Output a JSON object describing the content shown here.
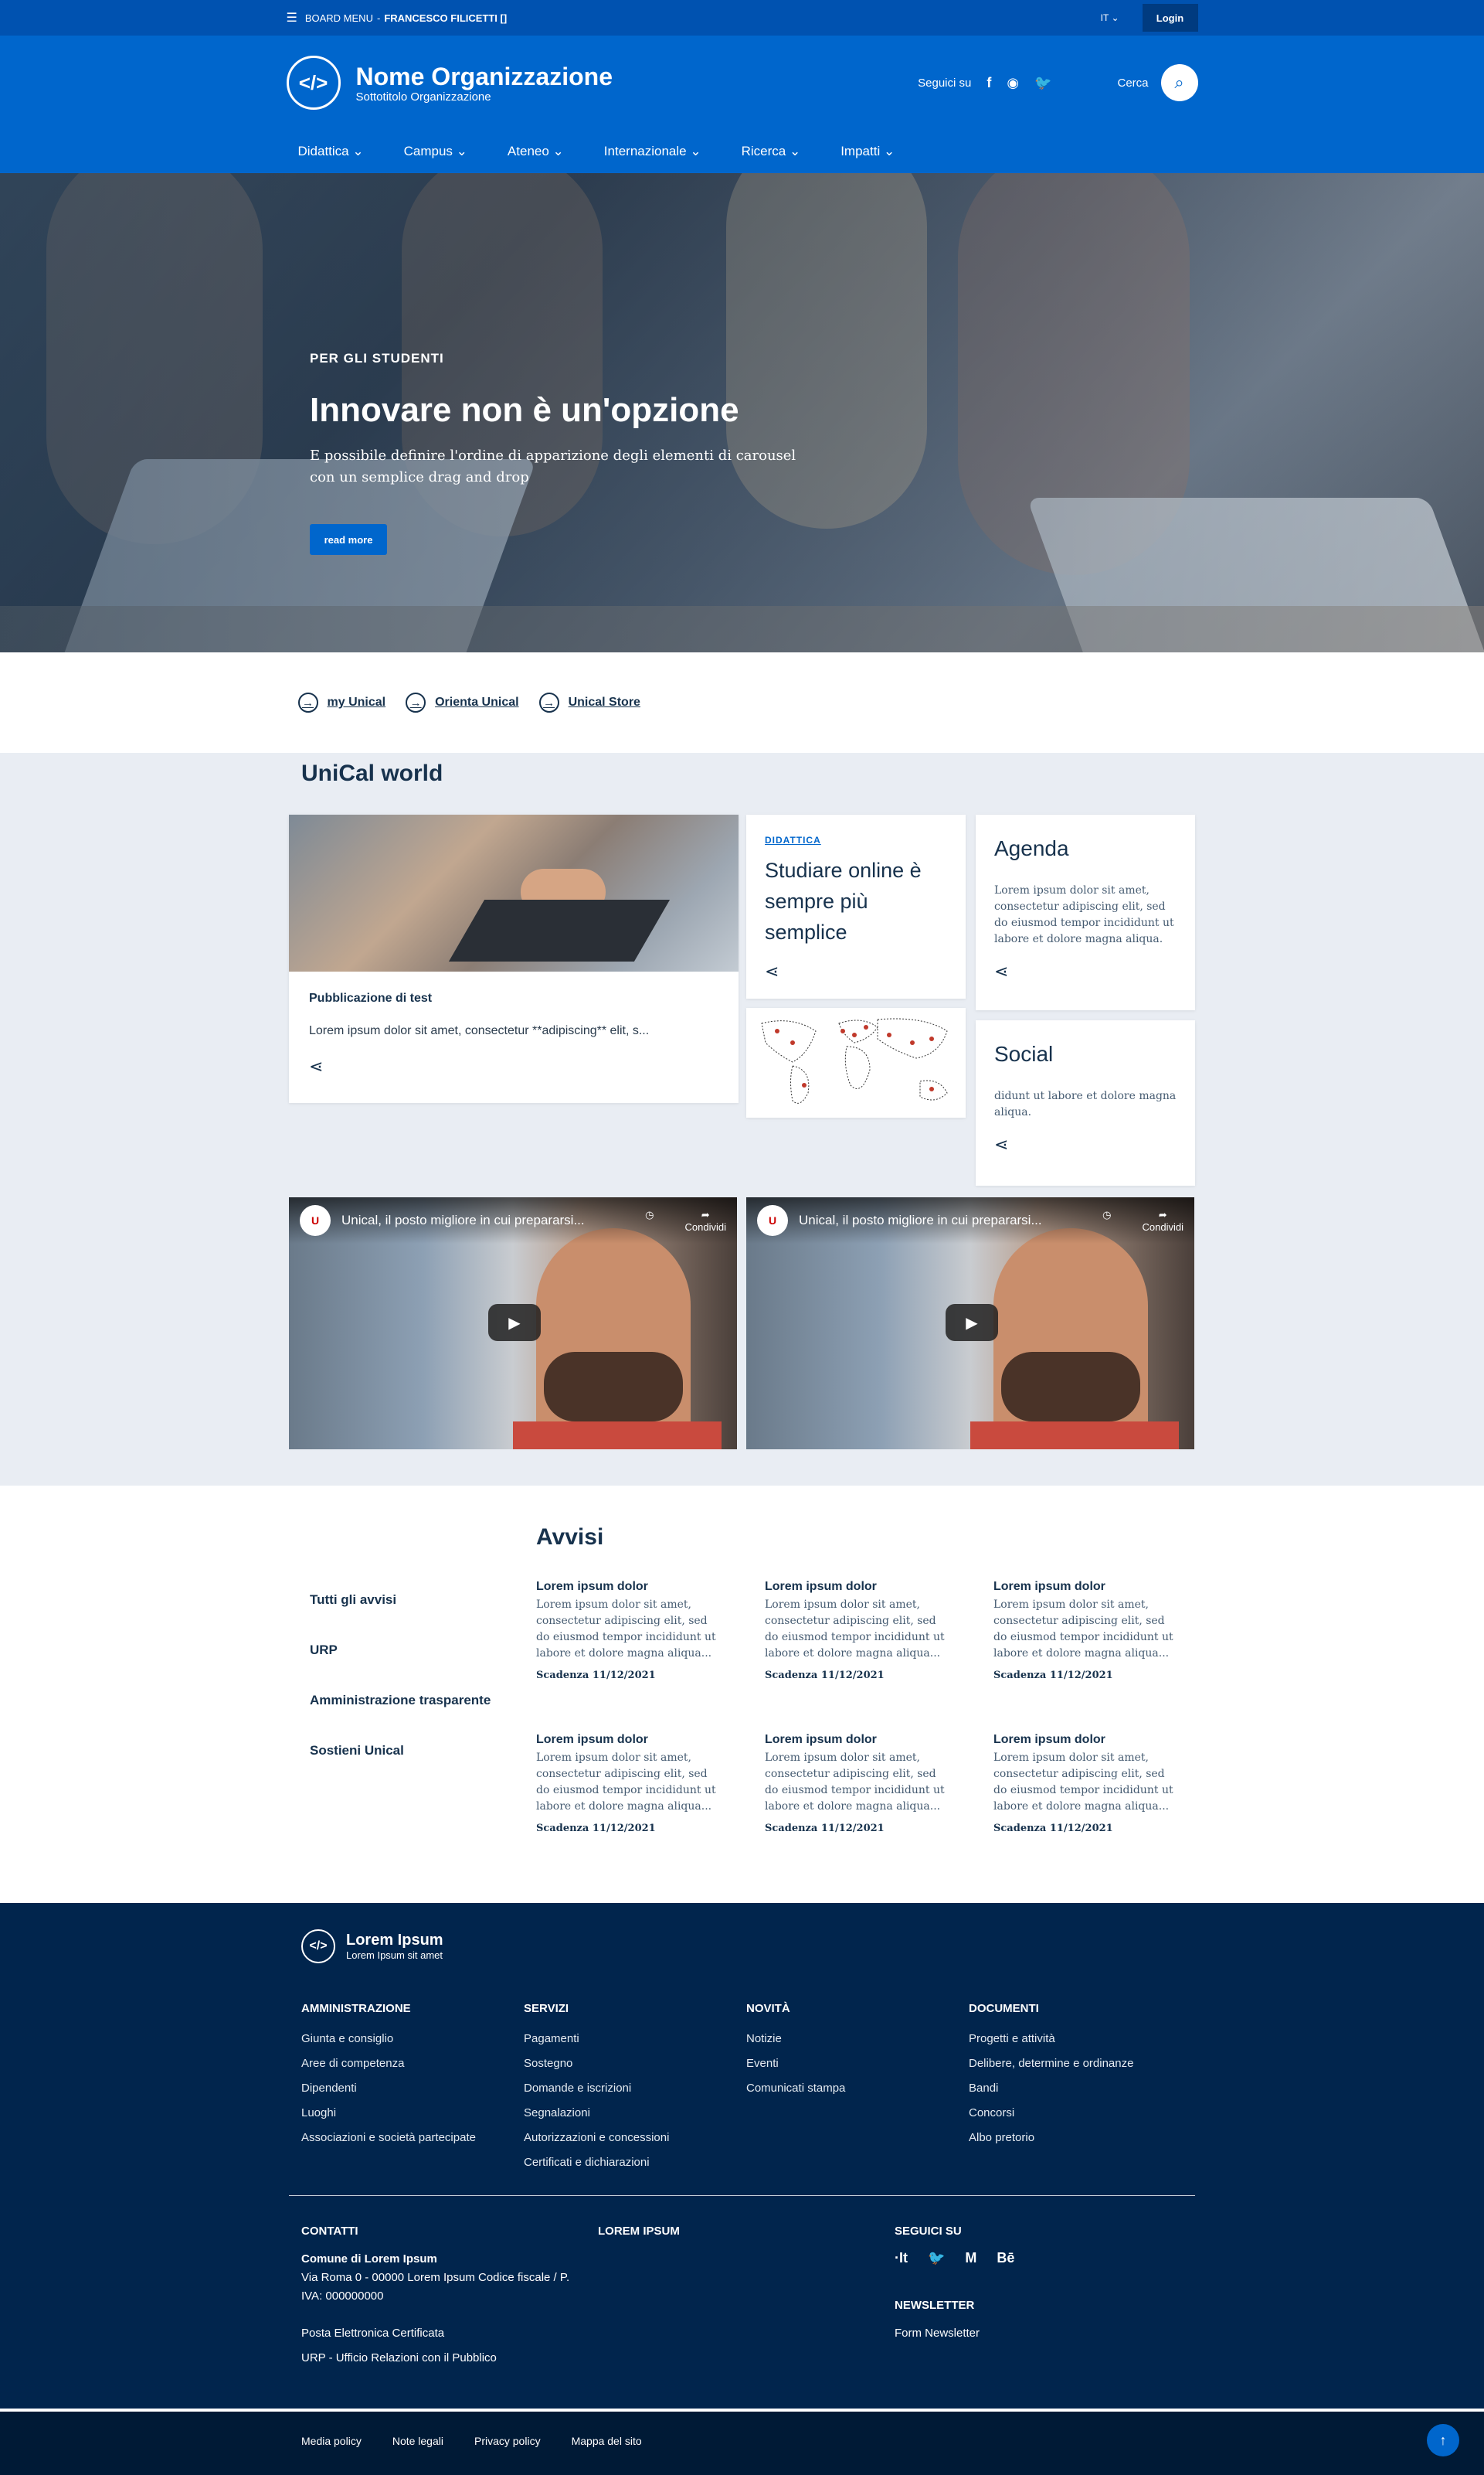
{
  "slim": {
    "menu_label": "BOARD MENU",
    "separator": "-",
    "user": "FRANCESCO FILICETTI []",
    "lang": "IT",
    "login": "Login"
  },
  "brand": {
    "title": "Nome Organizzazione",
    "subtitle": "Sottotitolo Organizzazione",
    "follow_label": "Seguici su",
    "search_label": "Cerca"
  },
  "nav": [
    {
      "label": "Didattica"
    },
    {
      "label": "Campus"
    },
    {
      "label": "Ateneo"
    },
    {
      "label": "Internazionale"
    },
    {
      "label": "Ricerca"
    },
    {
      "label": "Impatti"
    }
  ],
  "hero": {
    "kicker": "PER GLI STUDENTI",
    "title": "Innovare non è un'opzione",
    "text": "E possibile definire l'ordine di apparizione degli elementi di carousel con un semplice drag and drop",
    "button": "read more"
  },
  "quick_links": [
    "my Unical",
    "Orienta Unical",
    "Unical Store"
  ],
  "world": {
    "title": "UniCal world",
    "card_pub": {
      "title": "Pubblicazione di test",
      "text": "Lorem ipsum dolor sit amet, consectetur **adipiscing** elit, s..."
    },
    "card_did": {
      "category": "DIDATTICA",
      "title": "Studiare online è sempre più semplice"
    },
    "card_agenda": {
      "title": "Agenda",
      "text": "Lorem ipsum dolor sit amet, consectetur adipiscing elit, sed do eiusmod tempor incididunt ut labore et dolore magna aliqua."
    },
    "card_social": {
      "title": "Social",
      "text": "didunt ut labore et dolore magna aliqua."
    },
    "videos": [
      {
        "title": "Unical, il posto migliore in cui prepararsi...",
        "share": "Condividi"
      },
      {
        "title": "Unical, il posto migliore in cui prepararsi...",
        "share": "Condividi"
      }
    ]
  },
  "avvisi": {
    "title": "Avvisi",
    "menu": [
      "Tutti gli avvisi",
      "URP",
      "Amministrazione trasparente",
      "Sostieni Unical"
    ],
    "items": [
      {
        "title": "Lorem ipsum dolor",
        "text": "Lorem ipsum dolor sit amet, consectetur adipiscing elit, sed do eiusmod tempor incididunt ut labore et dolore magna aliqua...",
        "due": "Scadenza 11/12/2021"
      },
      {
        "title": "Lorem ipsum dolor",
        "text": "Lorem ipsum dolor sit amet, consectetur adipiscing elit, sed do eiusmod tempor incididunt ut labore et dolore magna aliqua...",
        "due": "Scadenza 11/12/2021"
      },
      {
        "title": "Lorem ipsum dolor",
        "text": "Lorem ipsum dolor sit amet, consectetur adipiscing elit, sed do eiusmod tempor incididunt ut labore et dolore magna aliqua...",
        "due": "Scadenza 11/12/2021"
      },
      {
        "title": "Lorem ipsum dolor",
        "text": "Lorem ipsum dolor sit amet, consectetur adipiscing elit, sed do eiusmod tempor incididunt ut labore et dolore magna aliqua...",
        "due": "Scadenza 11/12/2021"
      },
      {
        "title": "Lorem ipsum dolor",
        "text": "Lorem ipsum dolor sit amet, consectetur adipiscing elit, sed do eiusmod tempor incididunt ut labore et dolore magna aliqua...",
        "due": "Scadenza 11/12/2021"
      },
      {
        "title": "Lorem ipsum dolor",
        "text": "Lorem ipsum dolor sit amet, consectetur adipiscing elit, sed do eiusmod tempor incididunt ut labore et dolore magna aliqua...",
        "due": "Scadenza 11/12/2021"
      }
    ]
  },
  "footer": {
    "brand_title": "Lorem Ipsum",
    "brand_sub": "Lorem Ipsum sit amet",
    "cols": [
      {
        "title": "AMMINISTRAZIONE",
        "links": [
          "Giunta e consiglio",
          "Aree di competenza",
          "Dipendenti",
          "Luoghi",
          "Associazioni e società partecipate"
        ]
      },
      {
        "title": "SERVIZI",
        "links": [
          "Pagamenti",
          "Sostegno",
          "Domande e iscrizioni",
          "Segnalazioni",
          "Autorizzazioni e concessioni",
          "Certificati e dichiarazioni"
        ]
      },
      {
        "title": "NOVITÀ",
        "links": [
          "Notizie",
          "Eventi",
          "Comunicati stampa"
        ]
      },
      {
        "title": "DOCUMENTI",
        "links": [
          "Progetti e attività",
          "Delibere, determine e ordinanze",
          "Bandi",
          "Concorsi",
          "Albo pretorio"
        ]
      }
    ],
    "contacts_title": "CONTATTI",
    "contacts_name": "Comune di Lorem Ipsum",
    "contacts_addr": "Via Roma 0 - 00000 Lorem Ipsum Codice fiscale / P. IVA: 000000000",
    "pec": "Posta Elettronica Certificata",
    "urp": "URP - Ufficio Relazioni con il Pubblico",
    "lorem_title": "LOREM IPSUM",
    "follow_title": "SEGUICI SU",
    "social": [
      "·It",
      "🐦",
      "M",
      "Bē"
    ],
    "newsletter_title": "NEWSLETTER",
    "newsletter_link": "Form Newsletter"
  },
  "bottom": [
    "Media policy",
    "Note legali",
    "Privacy policy",
    "Mappa del sito"
  ]
}
